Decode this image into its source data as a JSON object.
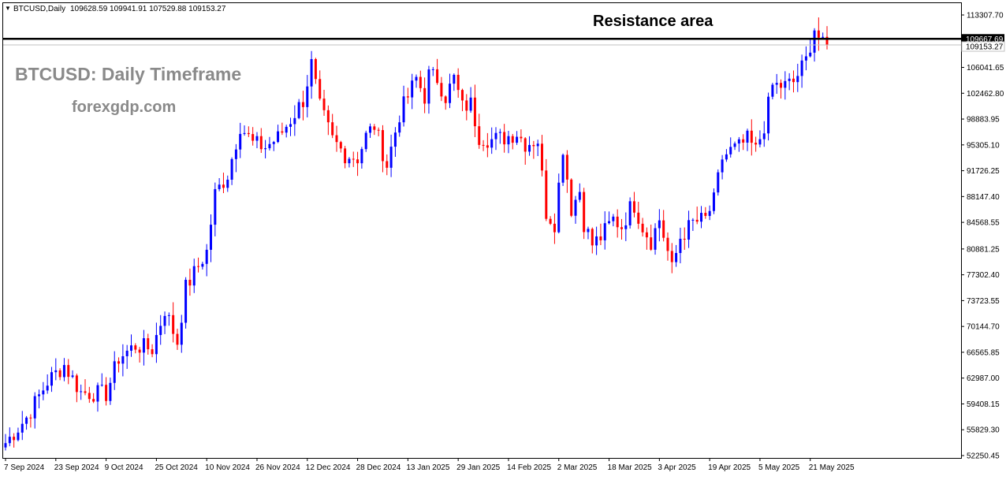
{
  "header": {
    "symbol_label": "BTCUSD,Daily",
    "ohlc_label": "109628.59 109941.91 107529.88 109153.27"
  },
  "watermark": {
    "title": "BTCUSD: Daily Timeframe",
    "site": "forexgdp.com"
  },
  "annotation": {
    "resistance_label": "Resistance area",
    "resistance_price": 110000
  },
  "price_tags": {
    "resistance_tag": "109667.69",
    "current_tag": "109153.27",
    "current_price": 109153.27
  },
  "colors": {
    "bull": "#0000ff",
    "bear": "#ff0000",
    "axis": "#000000",
    "resistance_line": "#000000",
    "current_line": "#c0c0c0"
  },
  "chart_data": {
    "type": "candlestick",
    "title": "",
    "ylim": [
      52250.45,
      113307.7
    ],
    "y_ticks": [
      "113307.70",
      "109728.95",
      "106041.65",
      "102462.80",
      "98883.95",
      "95305.10",
      "91726.25",
      "88147.40",
      "84568.55",
      "80881.25",
      "77302.40",
      "73723.55",
      "70144.70",
      "66565.85",
      "62987.00",
      "59408.15",
      "55829.30",
      "52250.45"
    ],
    "x_ticks": [
      {
        "label": "7 Sep 2024",
        "i": 0
      },
      {
        "label": "23 Sep 2024",
        "i": 12
      },
      {
        "label": "9 Oct 2024",
        "i": 24
      },
      {
        "label": "25 Oct 2024",
        "i": 36
      },
      {
        "label": "10 Nov 2024",
        "i": 48
      },
      {
        "label": "26 Nov 2024",
        "i": 60
      },
      {
        "label": "12 Dec 2024",
        "i": 72
      },
      {
        "label": "28 Dec 2024",
        "i": 84
      },
      {
        "label": "13 Jan 2025",
        "i": 96
      },
      {
        "label": "29 Jan 2025",
        "i": 108
      },
      {
        "label": "14 Feb 2025",
        "i": 120
      },
      {
        "label": "2 Mar 2025",
        "i": 132
      },
      {
        "label": "18 Mar 2025",
        "i": 144
      },
      {
        "label": "3 Apr 2025",
        "i": 156
      },
      {
        "label": "19 Apr 2025",
        "i": 168
      },
      {
        "label": "5 May 2025",
        "i": 180
      },
      {
        "label": "21 May 2025",
        "i": 192
      }
    ],
    "candle_count": 197,
    "anchors": [
      [
        0,
        54000
      ],
      [
        5,
        57500
      ],
      [
        10,
        62500
      ],
      [
        14,
        64800
      ],
      [
        18,
        61000
      ],
      [
        24,
        60800
      ],
      [
        27,
        65800
      ],
      [
        31,
        67500
      ],
      [
        35,
        67000
      ],
      [
        38,
        72500
      ],
      [
        41,
        68000
      ],
      [
        43,
        75500
      ],
      [
        46,
        78500
      ],
      [
        48,
        80500
      ],
      [
        50,
        88500
      ],
      [
        53,
        91200
      ],
      [
        56,
        98000
      ],
      [
        59,
        95500
      ],
      [
        62,
        95000
      ],
      [
        65,
        96300
      ],
      [
        68,
        98800
      ],
      [
        71,
        101500
      ],
      [
        73,
        106500
      ],
      [
        75,
        100500
      ],
      [
        78,
        96000
      ],
      [
        81,
        94000
      ],
      [
        84,
        93500
      ],
      [
        86,
        96500
      ],
      [
        88,
        98000
      ],
      [
        91,
        92500
      ],
      [
        94,
        99500
      ],
      [
        98,
        104500
      ],
      [
        100,
        102000
      ],
      [
        101,
        105000
      ],
      [
        103,
        104500
      ],
      [
        105,
        102000
      ],
      [
        107,
        104500
      ],
      [
        109,
        100500
      ],
      [
        111,
        101000
      ],
      [
        113,
        96500
      ],
      [
        116,
        96000
      ],
      [
        119,
        96300
      ],
      [
        122,
        97000
      ],
      [
        124,
        95500
      ],
      [
        127,
        96000
      ],
      [
        129,
        86000
      ],
      [
        131,
        84500
      ],
      [
        133,
        95000
      ],
      [
        135,
        86500
      ],
      [
        137,
        89000
      ],
      [
        138,
        84500
      ],
      [
        140,
        81500
      ],
      [
        142,
        82500
      ],
      [
        145,
        85000
      ],
      [
        147,
        84000
      ],
      [
        149,
        86500
      ],
      [
        150,
        87000
      ],
      [
        152,
        84000
      ],
      [
        154,
        82000
      ],
      [
        156,
        85000
      ],
      [
        158,
        80500
      ],
      [
        159,
        78000
      ],
      [
        161,
        82500
      ],
      [
        164,
        84500
      ],
      [
        167,
        85000
      ],
      [
        169,
        87500
      ],
      [
        171,
        93500
      ],
      [
        173,
        94500
      ],
      [
        175,
        95000
      ],
      [
        177,
        96000
      ],
      [
        179,
        94500
      ],
      [
        181,
        98000
      ],
      [
        183,
        103500
      ],
      [
        186,
        103500
      ],
      [
        188,
        104000
      ],
      [
        191,
        107000
      ],
      [
        193,
        111500
      ],
      [
        195,
        109000
      ],
      [
        196,
        109153.27
      ]
    ]
  }
}
